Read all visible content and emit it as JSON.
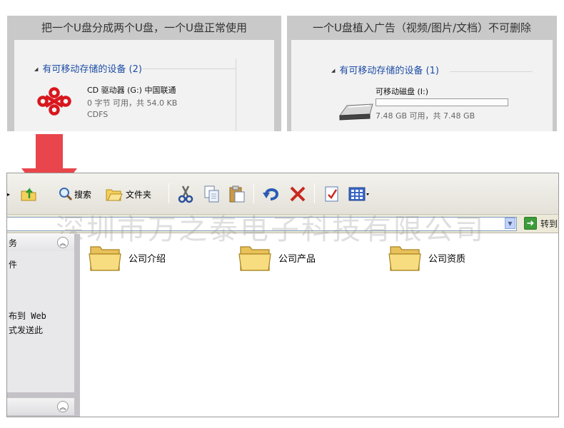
{
  "panels": {
    "left": {
      "title": "把一个U盘分成两个U盘，一个U盘正常使用",
      "group": "有可移动存储的设备 (2)",
      "drive_name": "CD 驱动器 (G:) 中国联通",
      "drive_space": "0 字节 可用，共 54.0 KB",
      "drive_fs": "CDFS"
    },
    "right": {
      "title": "一个U盘植入广告（视频/图片/文档）不可删除",
      "group": "有可移动存储的设备 (1)",
      "drive_name": "可移动磁盘 (I:)",
      "drive_space": "7.48 GB 可用，共 7.48 GB",
      "usage_fraction": 0.0
    }
  },
  "toolbar": {
    "search_label": "搜索",
    "folders_label": "文件夹"
  },
  "addressbar": {
    "go_label": "转到"
  },
  "watermark": "深圳市万之泰电子科技有限公司",
  "sidebar": {
    "tasks_title_fragment": "务",
    "item_fragment_1": "件",
    "item_fragment_2": "布到 Web",
    "item_fragment_3": "式发送此"
  },
  "folders": [
    {
      "name": "公司介绍"
    },
    {
      "name": "公司产品"
    },
    {
      "name": "公司资质"
    }
  ],
  "colors": {
    "arrow": "#e8464c",
    "link_blue": "#1e4ea5",
    "folder_yellow": "#f2d36b",
    "unicom_red": "#d9161d"
  }
}
